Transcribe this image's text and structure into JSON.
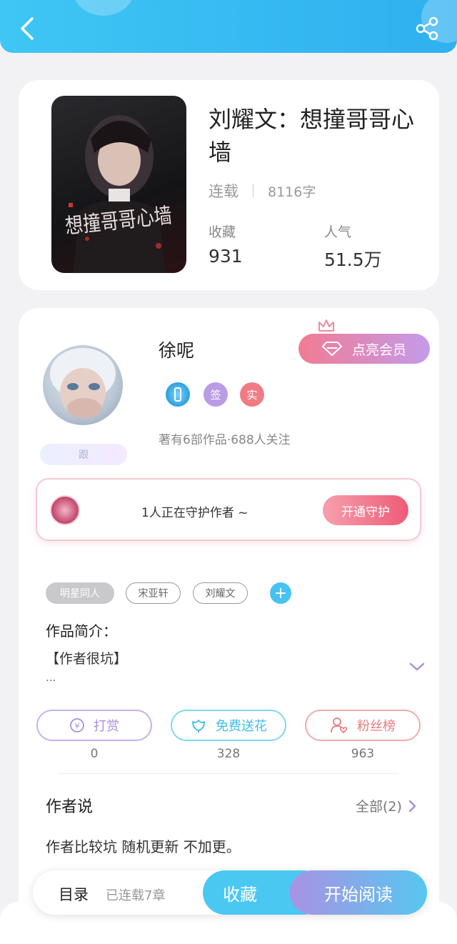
{
  "book": {
    "title": "刘耀文：想撞哥哥心墙",
    "status": "连载",
    "word_count": "8116字",
    "collect_label": "收藏",
    "collect_value": "931",
    "popularity_label": "人气",
    "popularity_value": "51.5万",
    "cover_text": "想撞哥哥心墙"
  },
  "author": {
    "name": "徐呢",
    "vip_button": "点亮会员",
    "badges": [
      "签",
      "实"
    ],
    "meta": "著有6部作品·688人关注",
    "follow_label": "跟"
  },
  "guard": {
    "text": "1人正在守护作者 ~",
    "button": "开通守护"
  },
  "tags": [
    "明星同人",
    "宋亚轩",
    "刘耀文"
  ],
  "intro": {
    "title": "作品简介：",
    "body": "【作者很坑】",
    "more": "..."
  },
  "actions": [
    {
      "label": "打赏",
      "count": "0",
      "color": "#b89be6"
    },
    {
      "label": "免费送花",
      "count": "328",
      "color": "#4ac8ee"
    },
    {
      "label": "粉丝榜",
      "count": "963",
      "color": "#ef8d8d"
    }
  ],
  "author_says": {
    "title": "作者说",
    "all": "全部(2)",
    "body": "作者比较坑 随机更新 不加更。"
  },
  "bottom_bar": {
    "toc": "目录",
    "toc_count": "已连载7章",
    "favorite": "收藏",
    "read": "开始阅读"
  },
  "colors": {
    "header": "#3fc6f4",
    "accent_blue": "#4ac8f2",
    "accent_pink": "#ee5b76",
    "accent_purple": "#a992e4"
  }
}
